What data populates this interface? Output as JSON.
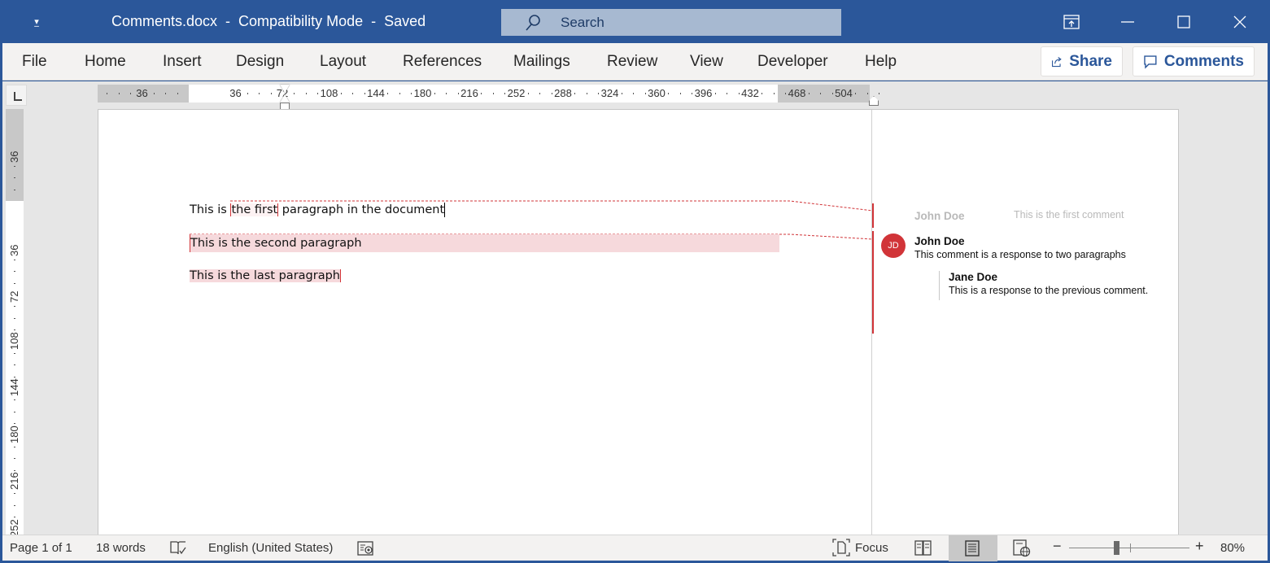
{
  "titlebar": {
    "qat_icon": "customize-quick-access-icon",
    "title": "Comments.docx  -  Compatibility Mode  -  Saved",
    "search_placeholder": "Search",
    "controls": [
      "ribbon-display-options",
      "minimize",
      "maximize",
      "close"
    ]
  },
  "ribbon": {
    "tabs": [
      "File",
      "Home",
      "Insert",
      "Design",
      "Layout",
      "References",
      "Mailings",
      "Review",
      "View",
      "Developer",
      "Help"
    ],
    "share_label": "Share",
    "comments_label": "Comments"
  },
  "ruler": {
    "horizontal_labels": [
      "36",
      "36",
      "72",
      "108",
      "144",
      "180",
      "216",
      "252",
      "288",
      "324",
      "360",
      "396",
      "432",
      "468",
      "504"
    ],
    "vertical_labels": [
      "36",
      "36",
      "72",
      "108",
      "144",
      "180",
      "216",
      "252"
    ]
  },
  "document": {
    "paragraphs": [
      {
        "before": "This is ",
        "commented": "the first",
        "after": " paragraph in the document"
      },
      {
        "text": "This is the second paragraph"
      },
      {
        "text": "This is the last paragraph"
      }
    ]
  },
  "comments": [
    {
      "author": "John Doe",
      "text": "This is the first comment",
      "resolved_style": true
    },
    {
      "author": "John Doe",
      "initials": "JD",
      "text": "This comment is a response to two paragraphs"
    },
    {
      "author": "Jane Doe",
      "text": "This is a response to the previous comment.",
      "reply": true
    }
  ],
  "colors": {
    "brand": "#2b579a",
    "comment_accent": "#d13438",
    "comment_highlight": "#f6d9dc"
  },
  "statusbar": {
    "page": "Page 1 of 1",
    "words": "18 words",
    "language": "English (United States)",
    "focus_label": "Focus",
    "zoom_minus": "−",
    "zoom_plus": "+",
    "zoom_level": "80%",
    "zoom_percent": 80
  }
}
